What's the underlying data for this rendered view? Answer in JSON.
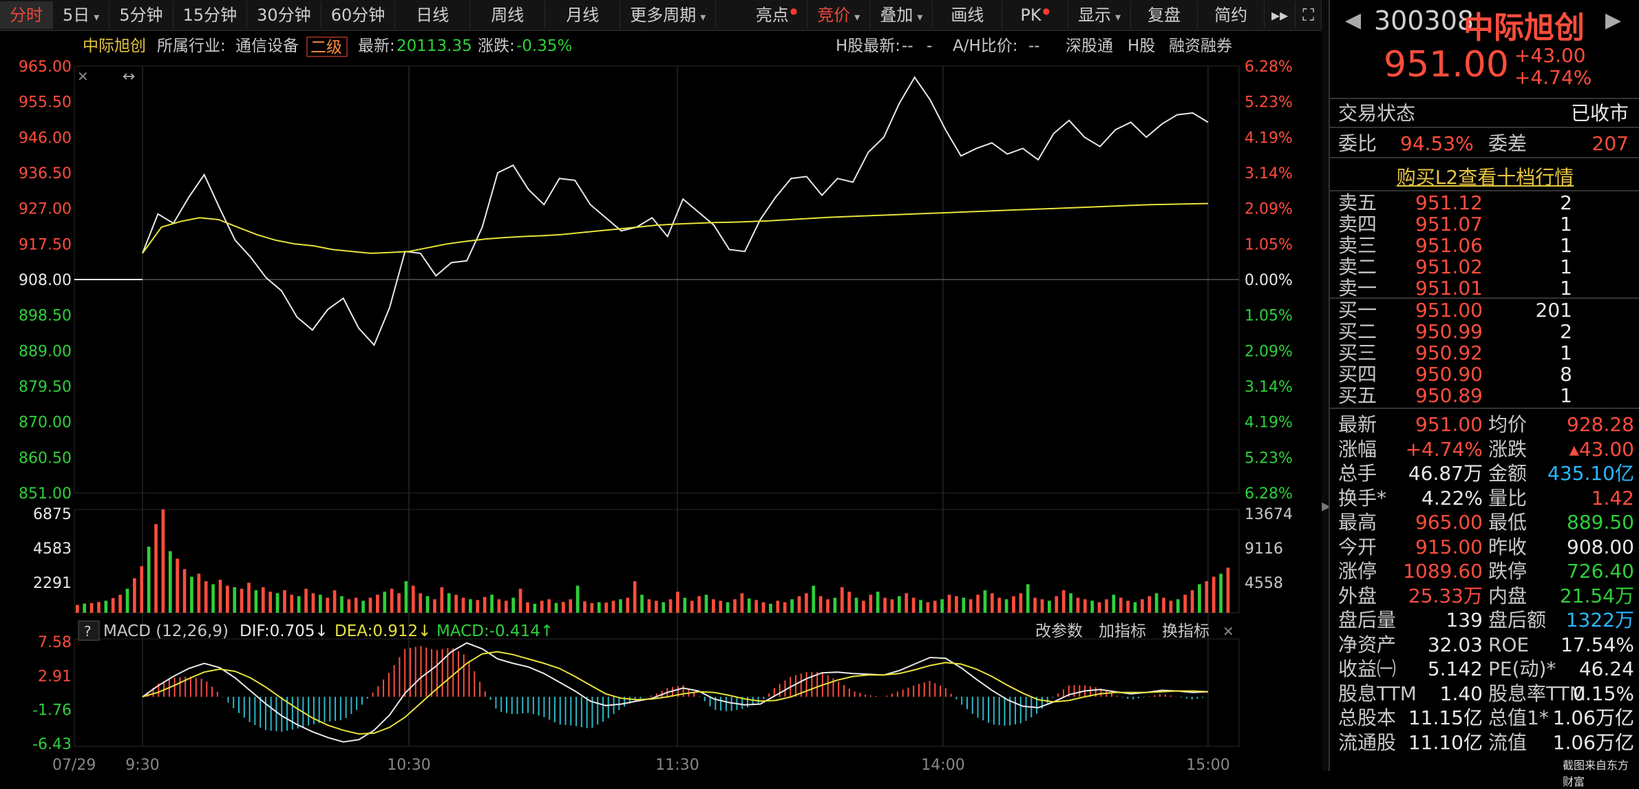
{
  "toolbar": {
    "left": [
      "分时",
      "5日",
      "5分钟",
      "15分钟",
      "30分钟",
      "60分钟",
      "日线",
      "周线",
      "月线",
      "更多周期"
    ],
    "right": [
      "亮点",
      "竞价",
      "叠加",
      "画线",
      "PK",
      "显示",
      "复盘",
      "简约"
    ],
    "active_left": "分时",
    "active_right": "竞价"
  },
  "info_bar": {
    "name": "中际旭创",
    "industry_label": "所属行业:",
    "industry": "通信设备",
    "level": "二级",
    "latest_label": "最新:",
    "latest": "20113.35",
    "change_label": "涨跌:",
    "change": "-0.35%",
    "hshare_label": "H股最新:",
    "hshare": "--",
    "hshare_sep": "-",
    "ah_label": "A/H比价:",
    "ah": "--",
    "links": [
      "深股通",
      "H股",
      "融资融券"
    ]
  },
  "chart_data": {
    "type": "line",
    "title": "",
    "x": [
      "9:30",
      "10:30",
      "11:30",
      "14:00",
      "15:00"
    ],
    "xlabel_left": "07/29",
    "price_ticks": [
      "965.00",
      "955.50",
      "946.00",
      "936.50",
      "927.00",
      "917.50",
      "908.00",
      "898.50",
      "889.00",
      "879.50",
      "870.00",
      "860.50",
      "851.00"
    ],
    "pct_ticks": [
      "6.28%",
      "5.23%",
      "4.19%",
      "3.14%",
      "2.09%",
      "1.05%",
      "0.00%",
      "1.05%",
      "2.09%",
      "3.14%",
      "4.19%",
      "5.23%",
      "6.28%"
    ],
    "ylim": [
      851.0,
      965.0
    ],
    "prev_close": 908.0,
    "price_series": [
      915.0,
      925.5,
      923.0,
      930.0,
      936.0,
      927.0,
      918.5,
      914.0,
      908.5,
      905.0,
      898.0,
      894.5,
      900.0,
      903.0,
      895.0,
      890.5,
      900.5,
      915.5,
      915.0,
      909.0,
      912.5,
      913.0,
      922.0,
      936.5,
      938.5,
      932.0,
      928.0,
      935.0,
      934.5,
      928.0,
      924.5,
      921.0,
      922.0,
      924.5,
      919.5,
      929.5,
      926.0,
      922.5,
      916.0,
      915.5,
      924.0,
      930.0,
      935.0,
      935.5,
      930.5,
      935.0,
      934.0,
      942.0,
      946.0,
      955.0,
      962.0,
      956.0,
      948.0,
      941.0,
      943.0,
      944.5,
      941.5,
      943.0,
      940.0,
      947.0,
      950.5,
      946.0,
      943.5,
      948.0,
      950.0,
      946.0,
      949.5,
      952.0,
      952.5,
      950.0
    ],
    "avg_series": [
      915.0,
      922.0,
      923.5,
      924.5,
      924.0,
      922.0,
      920.0,
      918.5,
      917.5,
      917.0,
      916.0,
      915.5,
      915.0,
      915.2,
      915.5,
      916.5,
      917.5,
      918.2,
      918.8,
      919.2,
      919.5,
      919.7,
      920.0,
      920.5,
      921.0,
      921.5,
      922.0,
      922.5,
      922.8,
      923.0,
      923.2,
      923.3,
      923.5,
      923.7,
      924.0,
      924.3,
      924.6,
      924.8,
      925.0,
      925.2,
      925.4,
      925.6,
      925.8,
      926.0,
      926.2,
      926.4,
      926.6,
      926.8,
      927.0,
      927.2,
      927.4,
      927.6,
      927.8,
      928.0,
      928.1,
      928.2,
      928.3
    ],
    "volume_ticks_left": [
      "6875",
      "4583",
      "2291"
    ],
    "volume_ticks_right": [
      "13674",
      "9116",
      "4558"
    ],
    "volume_max": 6875,
    "volume_series": [
      520,
      610,
      640,
      720,
      800,
      980,
      1200,
      1600,
      2300,
      3100,
      4400,
      5900,
      6875,
      4100,
      3600,
      2900,
      2400,
      2600,
      2100,
      1900,
      2200,
      1800,
      1700,
      1600,
      2000,
      1500,
      1700,
      1400,
      1300,
      1500,
      1200,
      1100,
      1600,
      1300,
      1200,
      1000,
      1500,
      1100,
      900,
      1000,
      800,
      1000,
      1200,
      1400,
      1600,
      1300,
      2100,
      1800,
      1300,
      1100,
      900,
      1700,
      1300,
      1200,
      1000,
      900,
      850,
      1050,
      1200,
      900,
      800,
      1000,
      1600,
      700,
      600,
      800,
      900,
      650,
      720,
      900,
      1800,
      760,
      640,
      700,
      680,
      800,
      900,
      1000,
      2100,
      1200,
      900,
      800,
      700,
      900,
      1400,
      1000,
      800,
      1100,
      1200,
      900,
      800,
      700,
      900,
      1300,
      950,
      850,
      700,
      600,
      800,
      700,
      900,
      1100,
      1300,
      1800,
      1100,
      900,
      1000,
      1700,
      1400,
      1000,
      800,
      1200,
      1400,
      1000,
      900,
      1100,
      1300,
      1000,
      850,
      700,
      800,
      900,
      1200,
      1100,
      1000,
      900,
      1200,
      1500,
      1300,
      1000,
      900,
      1100,
      1300,
      1900,
      1000,
      900,
      800,
      1100,
      1500,
      1300,
      1000,
      900,
      800,
      700,
      900,
      1200,
      1000,
      800,
      700,
      900,
      1100,
      1300,
      1000,
      800,
      900,
      1200,
      1500,
      1900,
      2100,
      2400,
      2600,
      3000
    ],
    "macd_label": "MACD (12,26,9)",
    "dif_label": "DIF:0.705↓",
    "dea_label": "DEA:0.912↓",
    "macd_value_label": "MACD:-0.414↑",
    "macd_ticks": [
      "7.58",
      "2.91",
      "-1.76",
      "-6.43"
    ],
    "macd_ylim": [
      -6.43,
      7.58
    ],
    "dif_series": [
      0.0,
      1.5,
      2.8,
      3.9,
      4.6,
      4.0,
      2.6,
      0.8,
      -1.0,
      -2.6,
      -3.8,
      -4.8,
      -5.6,
      -6.2,
      -5.9,
      -4.6,
      -2.5,
      0.5,
      2.6,
      4.2,
      6.2,
      7.4,
      6.6,
      5.2,
      4.6,
      4.1,
      3.2,
      2.0,
      0.8,
      -0.6,
      -1.2,
      -1.0,
      -0.6,
      -0.2,
      0.6,
      1.2,
      0.8,
      -0.3,
      -0.8,
      -1.1,
      -1.0,
      0.2,
      1.4,
      2.5,
      3.3,
      3.4,
      3.2,
      3.1,
      3.0,
      3.6,
      4.5,
      5.4,
      5.3,
      4.0,
      2.4,
      0.9,
      -0.4,
      -1.3,
      -1.5,
      -0.7,
      0.3,
      0.8,
      1.0,
      0.7,
      0.4,
      0.6,
      0.9,
      0.8,
      0.6,
      0.7
    ],
    "dea_series": [
      0.0,
      0.6,
      1.5,
      2.5,
      3.4,
      3.8,
      3.5,
      2.6,
      1.3,
      -0.2,
      -1.6,
      -2.9,
      -3.9,
      -4.6,
      -5.1,
      -5.0,
      -4.2,
      -2.8,
      -0.9,
      1.0,
      2.8,
      4.6,
      5.9,
      6.2,
      5.8,
      5.2,
      4.6,
      3.9,
      2.8,
      1.6,
      0.4,
      -0.2,
      -0.4,
      -0.3,
      0.0,
      0.4,
      0.7,
      0.6,
      0.2,
      -0.3,
      -0.6,
      -0.5,
      0.0,
      0.8,
      1.6,
      2.3,
      2.8,
      3.0,
      3.0,
      3.2,
      3.7,
      4.3,
      4.7,
      4.5,
      3.8,
      2.8,
      1.6,
      0.5,
      -0.4,
      -0.7,
      -0.5,
      0.0,
      0.4,
      0.6,
      0.6,
      0.6,
      0.7,
      0.8,
      0.8,
      0.7
    ]
  },
  "macd_controls": [
    "改参数",
    "加指标",
    "换指标"
  ],
  "quote": {
    "code": "300308",
    "name": "中际旭创",
    "price": "951.00",
    "change": "+43.00",
    "change_pct": "+4.74%",
    "status_label": "交易状态",
    "status": "已收市",
    "wb_label": "委比",
    "wb": "94.53%",
    "wc_label": "委差",
    "wc": "207",
    "l2_link": "购买L2查看十档行情",
    "asks": [
      {
        "label": "卖五",
        "price": "951.12",
        "vol": "2"
      },
      {
        "label": "卖四",
        "price": "951.07",
        "vol": "1"
      },
      {
        "label": "卖三",
        "price": "951.06",
        "vol": "1"
      },
      {
        "label": "卖二",
        "price": "951.02",
        "vol": "1"
      },
      {
        "label": "卖一",
        "price": "951.01",
        "vol": "1"
      }
    ],
    "bids": [
      {
        "label": "买一",
        "price": "951.00",
        "vol": "201"
      },
      {
        "label": "买二",
        "price": "950.99",
        "vol": "2"
      },
      {
        "label": "买三",
        "price": "950.92",
        "vol": "1"
      },
      {
        "label": "买四",
        "price": "950.90",
        "vol": "8"
      },
      {
        "label": "买五",
        "price": "950.89",
        "vol": "1"
      }
    ],
    "stats": [
      [
        "最新",
        "951.00",
        "red",
        "均价",
        "928.28",
        "red"
      ],
      [
        "涨幅",
        "+4.74%",
        "red",
        "涨跌",
        "▴43.00",
        "red"
      ],
      [
        "总手",
        "46.87万",
        "white",
        "金额",
        "435.10亿",
        "cyan"
      ],
      [
        "换手*",
        "4.22%",
        "white",
        "量比",
        "1.42",
        "red"
      ],
      [
        "最高",
        "965.00",
        "red",
        "最低",
        "889.50",
        "green"
      ],
      [
        "今开",
        "915.00",
        "red",
        "昨收",
        "908.00",
        "white"
      ],
      [
        "涨停",
        "1089.60",
        "red",
        "跌停",
        "726.40",
        "green"
      ],
      [
        "外盘",
        "25.33万",
        "red",
        "内盘",
        "21.54万",
        "green"
      ],
      [
        "盘后量",
        "139",
        "white",
        "盘后额",
        "1322万",
        "cyan"
      ],
      [
        "净资产",
        "32.03",
        "white",
        "ROE",
        "17.54%",
        "white"
      ],
      [
        "收益㈠",
        "5.142",
        "white",
        "PE(动)*",
        "46.24",
        "white"
      ],
      [
        "股息TTM",
        "1.40",
        "white",
        "股息率TTM",
        "0.15%",
        "white"
      ],
      [
        "总股本",
        "11.15亿",
        "white",
        "总值1*",
        "1.06万亿",
        "white"
      ],
      [
        "流通股",
        "11.10亿",
        "white",
        "流值",
        "1.06万亿",
        "white"
      ]
    ],
    "watermark": "截图来自东方财富"
  }
}
